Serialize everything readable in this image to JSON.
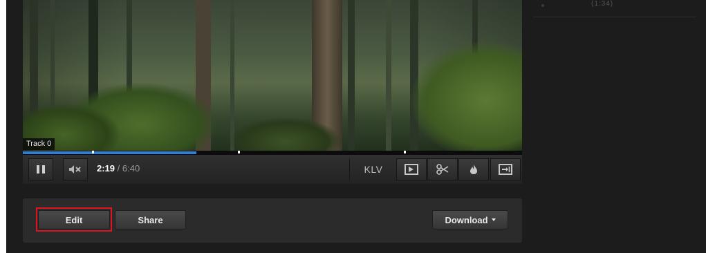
{
  "side_panel": {
    "snippet": "(1:34)"
  },
  "video": {
    "track_label": "Track 0",
    "progress_fraction": 0.3475
  },
  "controls": {
    "time_current": "2:19",
    "time_separator": " / ",
    "time_total": "6:40",
    "klv_label": "KLV",
    "icons": [
      "pause-icon",
      "mute-icon",
      "slideshow-icon",
      "scissors-icon",
      "fire-icon",
      "export-icon"
    ]
  },
  "actions": {
    "edit_label": "Edit",
    "share_label": "Share",
    "download_label": "Download"
  },
  "colors": {
    "progress": "#2f7fd6",
    "highlight": "#e0141e",
    "background": "#1c1c1c"
  }
}
